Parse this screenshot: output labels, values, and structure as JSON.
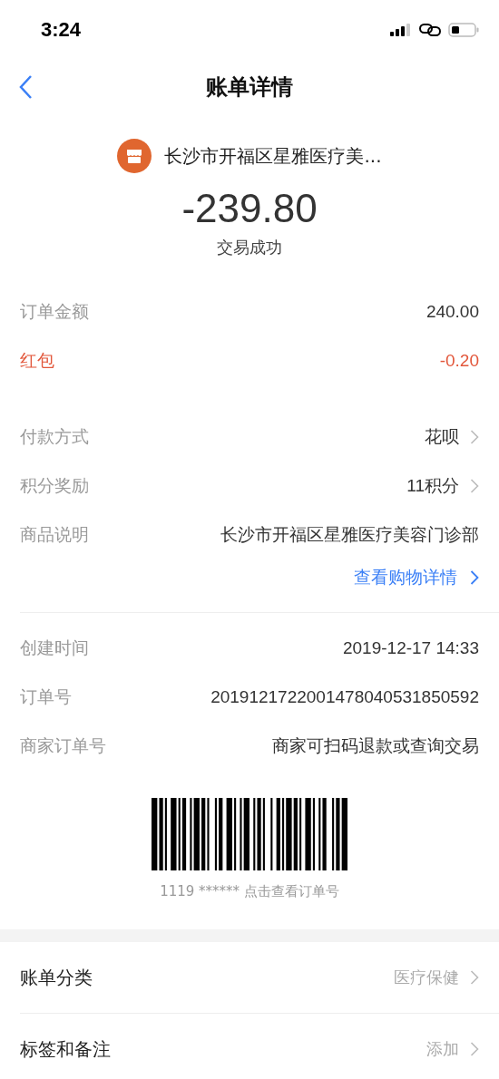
{
  "status_bar": {
    "time": "3:24"
  },
  "nav": {
    "title": "账单详情"
  },
  "merchant": {
    "name": "长沙市开福区星雅医疗美..."
  },
  "amount": "-239.80",
  "status": "交易成功",
  "sections": [
    {
      "rows": [
        {
          "label": "订单金额",
          "value": "240.00",
          "highlighted": false,
          "chevron": false
        },
        {
          "label": "红包",
          "value": "-0.20",
          "highlighted": true,
          "chevron": false
        }
      ]
    },
    {
      "rows": [
        {
          "label": "付款方式",
          "value": "花呗",
          "highlighted": false,
          "chevron": true
        },
        {
          "label": "积分奖励",
          "value": "11积分",
          "highlighted": false,
          "chevron": true
        },
        {
          "label": "商品说明",
          "value": "长沙市开福区星雅医疗美容门诊部",
          "highlighted": false,
          "chevron": false
        }
      ],
      "link": {
        "label": "查看购物详情"
      }
    },
    {
      "rows": [
        {
          "label": "创建时间",
          "value": "2019-12-17 14:33",
          "highlighted": false,
          "chevron": false
        },
        {
          "label": "订单号",
          "value": "2019121722001478040531850592",
          "highlighted": false,
          "chevron": false
        },
        {
          "label": "商家订单号",
          "value": "商家可扫码退款或查询交易",
          "highlighted": false,
          "chevron": false
        }
      ]
    }
  ],
  "barcode_caption": "1119 ****** 点击查看订单号",
  "bottom_rows": [
    {
      "label": "账单分类",
      "value": "医疗保健"
    },
    {
      "label": "标签和备注",
      "value": "添加"
    }
  ]
}
